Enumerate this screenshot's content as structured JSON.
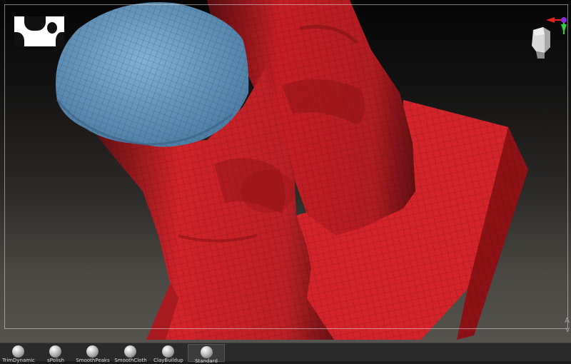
{
  "viewport": {
    "corner_labels": [
      "A",
      "V"
    ],
    "colors": {
      "mesh_red": "#d3242b",
      "mesh_blue": "#6b9bc3",
      "background": "#2b2926",
      "frame": "#e1e1e1"
    }
  },
  "navigation": {
    "gizmo_icon": "head-orientation-icon",
    "axis_colors": {
      "x": "#e0231f",
      "y": "#2fd33a",
      "z": "#8a2be2"
    }
  },
  "brushes": [
    {
      "label": "TrimDynamic",
      "selected": false
    },
    {
      "label": "sPolish",
      "selected": false
    },
    {
      "label": "SmoothPeaks",
      "selected": false
    },
    {
      "label": "SmoothCloth",
      "selected": false
    },
    {
      "label": "ClayBuildup",
      "selected": false
    },
    {
      "label": "Standard",
      "selected": true
    }
  ]
}
